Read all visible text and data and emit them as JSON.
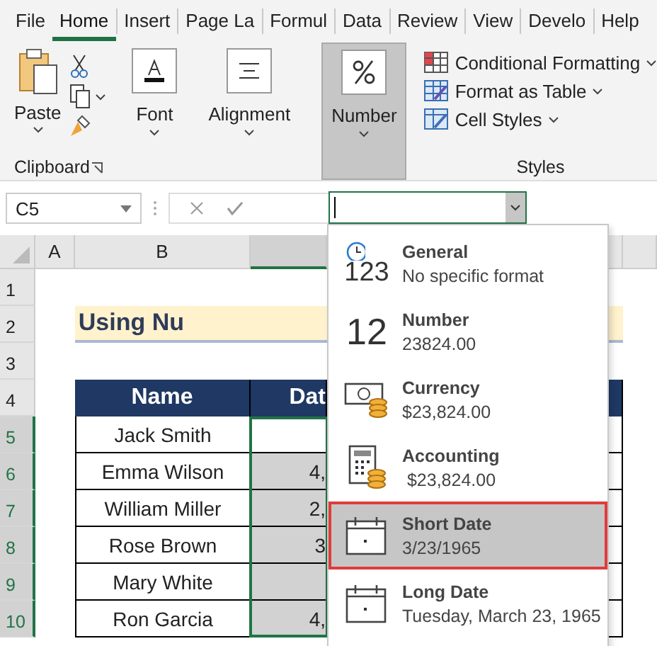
{
  "tabs": [
    {
      "label": "File",
      "selected": false
    },
    {
      "label": "Home",
      "selected": true
    },
    {
      "label": "Insert",
      "selected": false
    },
    {
      "label": "Page La",
      "selected": false
    },
    {
      "label": "Formul",
      "selected": false
    },
    {
      "label": "Data",
      "selected": false
    },
    {
      "label": "Review",
      "selected": false
    },
    {
      "label": "View",
      "selected": false
    },
    {
      "label": "Develo",
      "selected": false
    },
    {
      "label": "Help",
      "selected": false
    }
  ],
  "clipboard": {
    "paste": "Paste",
    "label": "Clipboard"
  },
  "groups": [
    {
      "label": "Font",
      "kind": "font",
      "pressed": false
    },
    {
      "label": "Alignment",
      "kind": "alignment",
      "pressed": false
    },
    {
      "label": "Number",
      "kind": "number",
      "pressed": true
    }
  ],
  "styles": {
    "items": [
      {
        "label": "Conditional Formatting",
        "kind": "conditional"
      },
      {
        "label": "Format as Table",
        "kind": "table"
      },
      {
        "label": "Cell Styles",
        "kind": "cellstyles"
      }
    ],
    "label": "Styles"
  },
  "name_box": "C5",
  "columns": [
    {
      "label": "A",
      "selected": false
    },
    {
      "label": "B",
      "selected": false
    },
    {
      "selected": true
    }
  ],
  "rows": [
    {
      "label": "1",
      "selected": false
    },
    {
      "label": "2",
      "selected": false
    },
    {
      "label": "3",
      "selected": false
    },
    {
      "label": "4",
      "selected": false
    },
    {
      "label": "5",
      "selected": true
    },
    {
      "label": "6",
      "selected": true
    },
    {
      "label": "7",
      "selected": true
    },
    {
      "label": "8",
      "selected": true
    },
    {
      "label": "9",
      "selected": true
    },
    {
      "label": "10",
      "selected": true
    }
  ],
  "sheet_title": "Using Nu",
  "table": {
    "columns": [
      "Name",
      "Dat"
    ],
    "rows": [
      {
        "name": "Jack Smith",
        "selected": false
      },
      {
        "name": "Emma Wilson",
        "date": "4,",
        "selected": true
      },
      {
        "name": "William Miller",
        "date": "2,",
        "selected": true
      },
      {
        "name": "Rose Brown",
        "date": "3",
        "selected": true
      },
      {
        "name": "Mary White",
        "selected": true
      },
      {
        "name": "Ron Garcia",
        "date": "4,",
        "selected": true
      }
    ]
  },
  "format_menu": [
    {
      "kind": "general",
      "icon_text": "123",
      "title": "General",
      "sample": "No specific format",
      "selected": false
    },
    {
      "kind": "number",
      "icon_text": "12",
      "title": "Number",
      "sample": "23824.00",
      "selected": false
    },
    {
      "kind": "currency",
      "title": "Currency",
      "sample": "$23,824.00",
      "selected": false
    },
    {
      "kind": "accounting",
      "title": "Accounting",
      "sample": " $23,824.00",
      "selected": false
    },
    {
      "kind": "date",
      "title": "Short Date",
      "sample": "3/23/1965",
      "selected": true
    },
    {
      "kind": "date",
      "title": "Long Date",
      "sample": "Tuesday, March 23, 1965",
      "selected": false
    }
  ]
}
